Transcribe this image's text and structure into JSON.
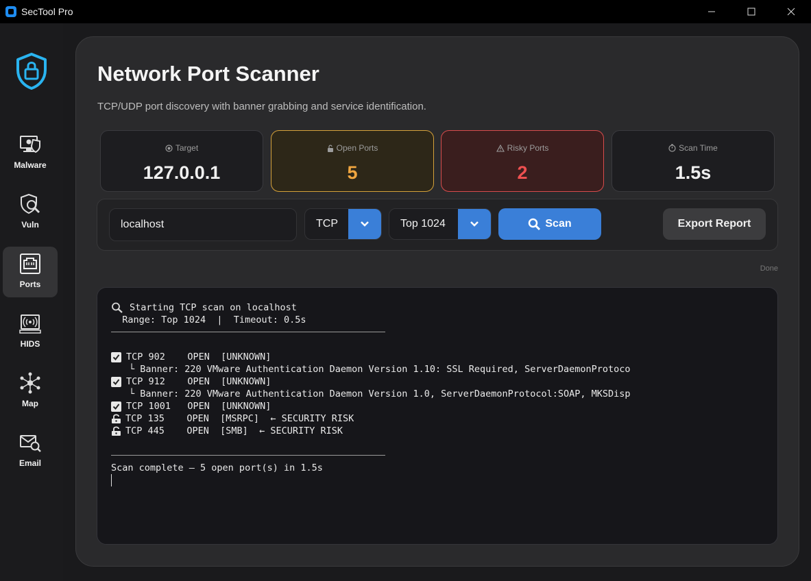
{
  "window": {
    "title": "SecTool Pro"
  },
  "sidebar": {
    "items": [
      {
        "label": "Malware",
        "icon": "malware-icon",
        "active": false
      },
      {
        "label": "Vuln",
        "icon": "vuln-icon",
        "active": false
      },
      {
        "label": "Ports",
        "icon": "ethernet-port-icon",
        "active": true
      },
      {
        "label": "HIDS",
        "icon": "hids-icon",
        "active": false
      },
      {
        "label": "Map",
        "icon": "network-map-icon",
        "active": false
      },
      {
        "label": "Email",
        "icon": "email-icon",
        "active": false
      }
    ]
  },
  "page": {
    "title": "Network Port Scanner",
    "subtitle": "TCP/UDP port discovery with banner grabbing and service identification."
  },
  "stats": {
    "target": {
      "label": "Target",
      "value": "127.0.0.1"
    },
    "open_ports": {
      "label": "Open Ports",
      "value": "5"
    },
    "risky_ports": {
      "label": "Risky Ports",
      "value": "2"
    },
    "scan_time": {
      "label": "Scan Time",
      "value": "1.5s"
    }
  },
  "controls": {
    "target_value": "localhost",
    "protocol": "TCP",
    "range": "Top 1024",
    "scan_label": "Scan",
    "export_label": "Export Report"
  },
  "status": "Done",
  "terminal": {
    "header": [
      "Starting TCP scan on localhost",
      "  Range: Top 1024  |  Timeout: 0.5s"
    ],
    "lines": [
      "TCP 902    OPEN  [UNKNOWN]",
      "└ Banner: 220 VMware Authentication Daemon Version 1.10: SSL Required, ServerDaemonProtoco",
      "TCP 912    OPEN  [UNKNOWN]",
      "└ Banner: 220 VMware Authentication Daemon Version 1.0, ServerDaemonProtocol:SOAP, MKSDisp",
      "TCP 1001   OPEN  [UNKNOWN]",
      "TCP 135    OPEN  [MSRPC]  ← SECURITY RISK",
      "TCP 445    OPEN  [SMB]  ← SECURITY RISK"
    ],
    "footer": "Scan complete — 5 open port(s) in 1.5s"
  },
  "colors": {
    "accent": "#3a7fd8",
    "open_ports": "#f0a640",
    "risk": "#ee5050"
  }
}
